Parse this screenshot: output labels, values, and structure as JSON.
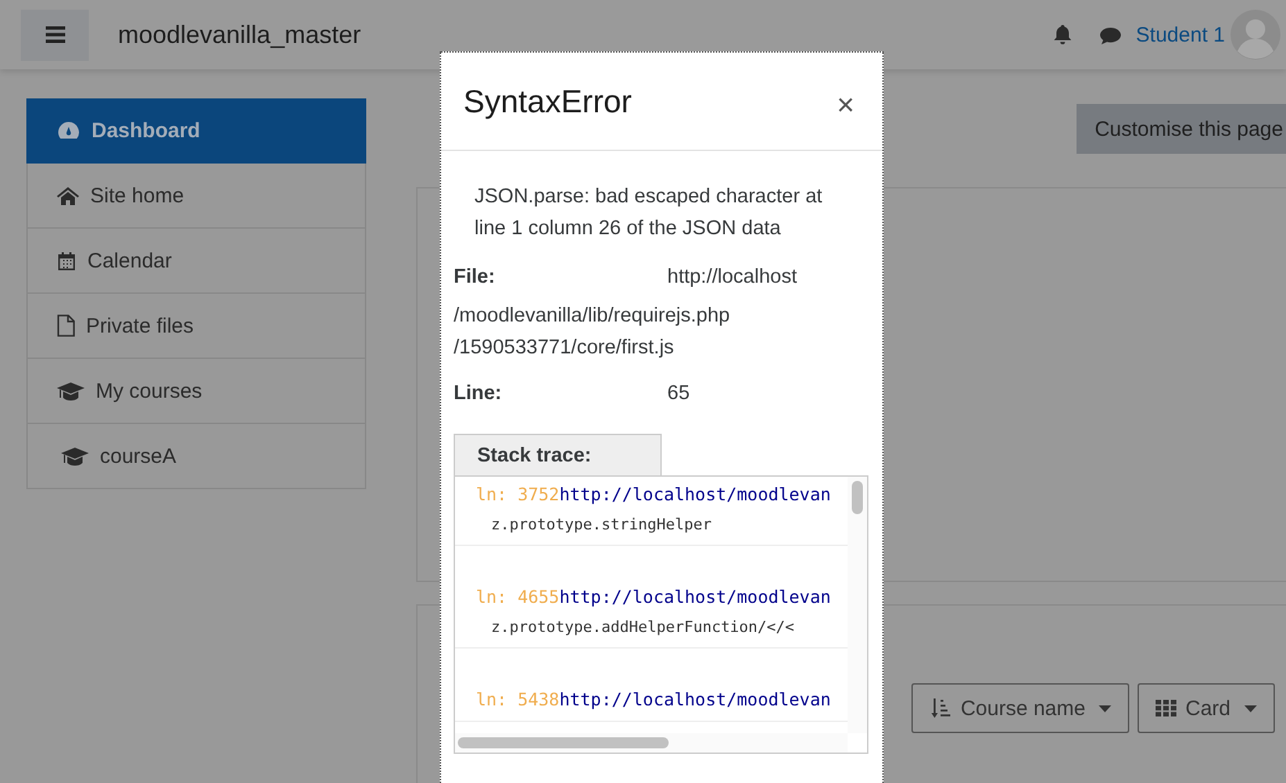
{
  "navbar": {
    "site_name": "moodlevanilla_master",
    "user_name": "Student 1"
  },
  "sidebar": {
    "items": [
      {
        "label": "Dashboard",
        "selected": true
      },
      {
        "label": "Site home",
        "selected": false
      },
      {
        "label": "Calendar",
        "selected": false
      },
      {
        "label": "Private files",
        "selected": false
      },
      {
        "label": "My courses",
        "selected": false
      },
      {
        "label": "courseA",
        "selected": false
      }
    ]
  },
  "page": {
    "customise_button": "Customise this page",
    "sort_dropdown": "Course name",
    "view_dropdown": "Card"
  },
  "dialog": {
    "title": "SyntaxError",
    "close": "×",
    "message": "JSON.parse: bad escaped character at line 1 column 26 of the JSON data",
    "fields": [
      {
        "label": "File:",
        "value": "http://localhost",
        "extra": [
          "/moodlevanilla/lib/requirejs.php",
          "/1590533771/core/first.js"
        ]
      },
      {
        "label": "Line:",
        "value": "65"
      }
    ],
    "stack_trace_label": "Stack trace:",
    "stack_trace": [
      {
        "line": "ln: 3752",
        "url": "http://localhost/moodlevan",
        "function": "z.prototype.stringHelper"
      },
      {
        "line": "ln: 4655",
        "url": "http://localhost/moodlevan",
        "function": "z.prototype.addHelperFunction/</<"
      },
      {
        "line": "ln: 5438",
        "url": "http://localhost/moodlevan"
      }
    ]
  }
}
